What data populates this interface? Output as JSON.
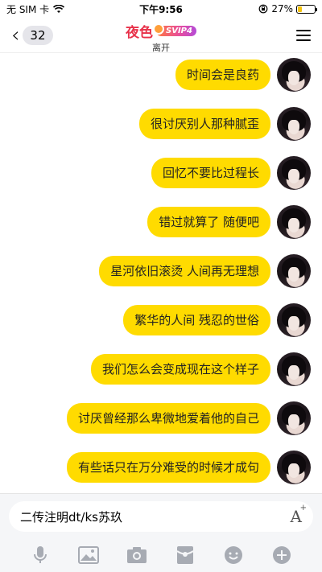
{
  "status_bar": {
    "carrier": "无 SIM 卡",
    "time": "下午9:56",
    "battery": "27%",
    "battery_level": 0.27
  },
  "nav": {
    "unread_count": "32",
    "title": "夜色",
    "vip_badge": "SVIP4",
    "subtitle": "离开"
  },
  "messages": [
    {
      "text": "时间会是良药"
    },
    {
      "text": "很讨厌别人那种腻歪"
    },
    {
      "text": "回忆不要比过程长"
    },
    {
      "text": "错过就算了 随便吧"
    },
    {
      "text": "星河依旧滚烫 人间再无理想"
    },
    {
      "text": "繁华的人间 残忍的世俗"
    },
    {
      "text": "我们怎么会变成现在这个样子"
    },
    {
      "text": "讨厌曾经那么卑微地爱着他的自己"
    },
    {
      "text": "有些话只在万分难受的时候才成句"
    }
  ],
  "input": {
    "value": "二传注明dt/ks苏玖"
  },
  "toolbar_icons": [
    "microphone-icon",
    "image-icon",
    "camera-icon",
    "red-packet-icon",
    "emoji-icon",
    "plus-icon"
  ],
  "colors": {
    "bubble": "#ffdb00",
    "title": "#e8324a",
    "icon_gray": "#a7abb3"
  }
}
